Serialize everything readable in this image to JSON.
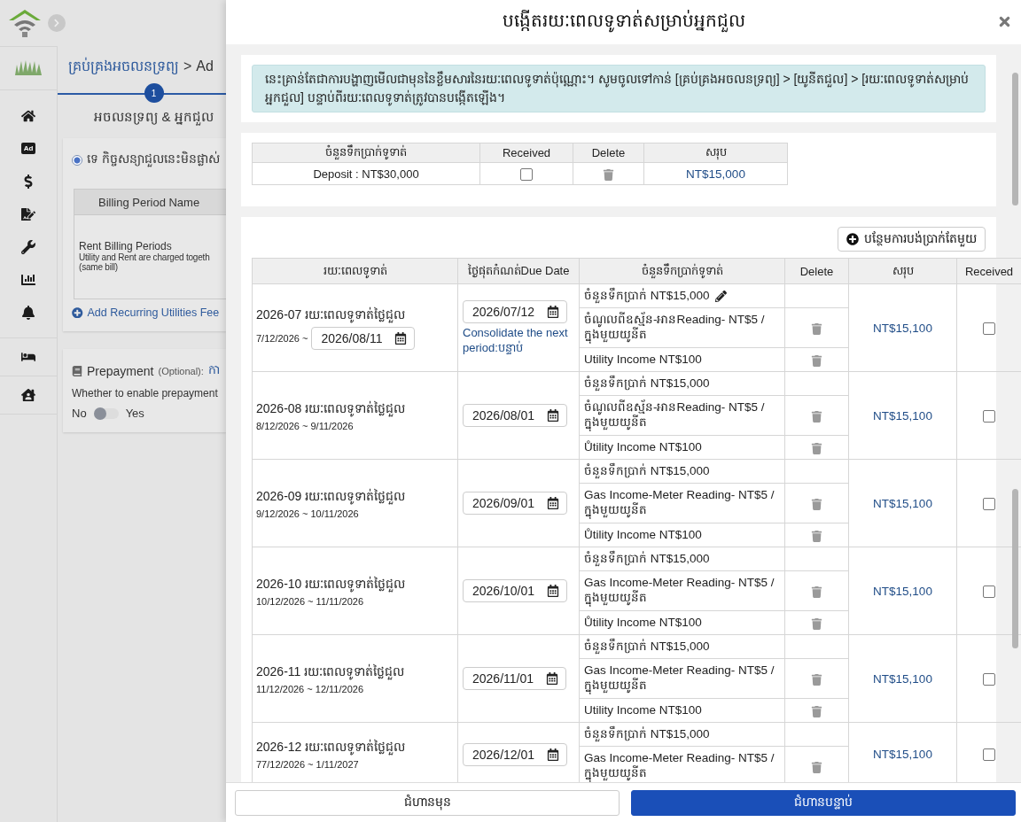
{
  "background": {
    "sidebar": {
      "items": [
        {
          "kind": "home"
        },
        {
          "kind": "ad",
          "label": "Ad"
        },
        {
          "kind": "dollar"
        },
        {
          "kind": "sign"
        },
        {
          "kind": "wrench"
        },
        {
          "kind": "chart"
        },
        {
          "kind": "bell"
        },
        {
          "kind": "bed"
        },
        {
          "kind": "house"
        }
      ]
    },
    "breadcrumb": {
      "link": "គ្រប់គ្រងអចលនទ្រព្យ",
      "separator": ">",
      "current": "Ad"
    },
    "stepper": {
      "steps": [
        {
          "number": "1",
          "label": "អចលនទ្រព្យ & អ្នកជួល",
          "selected": true
        }
      ]
    },
    "contract_option": {
      "label": "ទេ កិច្ចសន្យាជួលនេះមិនផ្លាស់",
      "selected": true
    },
    "billing_table": {
      "columns": [
        "Billing Period Name"
      ],
      "rows": [
        {
          "title": "Rent Billing Periods",
          "note_lines": [
            "Utility and Rent are charged togeth",
            "(same bill)"
          ]
        }
      ]
    },
    "add_fee_link": "Add Recurring Utilities Fee",
    "prepayment": {
      "title": "Prepayment",
      "optional": "(Optional):",
      "link": "កា",
      "question": "Whether to enable prepayment",
      "off_label": "No",
      "on_label": "Yes",
      "on": false
    }
  },
  "dialog": {
    "title": "បង្កើតរយៈពេលទូទាត់សម្រាប់អ្នកជួល",
    "notice": "នេះគ្រាន់តែជាការបង្ហាញមើលជាមុននៃខ្លឹមសារនៃរយៈពេលទូទាត់ប៉ុណ្ណោះ។ សូមចូលទៅកាន់ [គ្រប់គ្រងអចលនទ្រព្យ] > [យូនីតជួល] > [រយៈពេលទូទាត់សម្រាប់អ្នកជួល] បន្ទាប់ពីរយៈពេលទូទាត់ត្រូវបានបង្កើតឡើង។",
    "deposit_table": {
      "columns": [
        "ចំនួនទឹកប្រាក់ទូទាត់",
        "Received",
        "Delete",
        "សរុប"
      ],
      "rows": [
        {
          "amount": "Deposit : NT$30,000",
          "received": false,
          "total": "NT$15,000"
        }
      ]
    },
    "add_button": "បន្ថែមការបង់ប្រាក់តែមួយ",
    "periods_table": {
      "columns": [
        "រយៈពេលទូទាត់",
        "ថ្ងៃផុតកំណត់Due Date",
        "ចំនួនទឹកប្រាក់ទូទាត់",
        "Delete",
        "សរុប",
        "Received"
      ],
      "rows": [
        {
          "name": "2026-07 រយៈពេលទូទាត់ថ្លៃជួល",
          "range": "7/12/2026 ~",
          "end_date": "2026/08/11",
          "due_date": "2026/07/12",
          "consolidate": "Consolidate the next period:បន្ទាប់",
          "items": [
            {
              "text": "ចំនួនទឹកប្រាក់  NT$15,000",
              "editable": true,
              "deletable": false
            },
            {
              "text": "ចំណូលពីឧស្ម័ន-អានReading- NT$5 / ក្នុងមួយយូនីត",
              "editable": false,
              "deletable": true
            },
            {
              "text": "Utility Income NT$100",
              "editable": false,
              "deletable": true
            }
          ],
          "total": "NT$15,100",
          "received": false
        },
        {
          "name": "2026-08 រយៈពេលទូទាត់ថ្លៃជួល",
          "range": "8/12/2026 ~ 9/11/2026",
          "due_date": "2026/08/01",
          "items": [
            {
              "text": "ចំនួនទឹកប្រាក់  NT$15,000",
              "editable": false,
              "deletable": false
            },
            {
              "text": "ចំណូលពីឧស្ម័ន-អានReading- NT$5 / ក្នុងមួយយូនីត",
              "editable": false,
              "deletable": true
            },
            {
              "text": "Ůtility Income NT$100",
              "editable": false,
              "deletable": true
            }
          ],
          "total": "NT$15,100",
          "received": false
        },
        {
          "name": "2026-09 រយៈពេលទូទាត់ថ្លៃជួល",
          "range": "9/12/2026 ~ 10/11/2026",
          "due_date": "2026/09/01",
          "items": [
            {
              "text": "ចំនួនទឹកប្រាក់  NT$15,000",
              "editable": false,
              "deletable": false
            },
            {
              "text": "Gas Income-Meter Reading- NT$5 / ក្នុងមួយយូនីត",
              "editable": false,
              "deletable": true
            },
            {
              "text": "Ůtility Income NT$100",
              "editable": false,
              "deletable": true
            }
          ],
          "total": "NT$15,100",
          "received": false
        },
        {
          "name": "2026-10 រយៈពេលទូទាត់ថ្លៃជួល",
          "range": "10/12/2026 ~ 11/11/2026",
          "due_date": "2026/10/01",
          "items": [
            {
              "text": "ចំនួនទឹកប្រាក់  NT$15,000",
              "editable": false,
              "deletable": false
            },
            {
              "text": "Gas Income-Meter Reading- NT$5 / ក្នុងមួយយូនីត",
              "editable": false,
              "deletable": true
            },
            {
              "text": "Ůtility Income NT$100",
              "editable": false,
              "deletable": true
            }
          ],
          "total": "NT$15,100",
          "received": false
        },
        {
          "name": "2026-11 រយៈពេលទូទាត់ថ្លៃជួល",
          "range": "11/12/2026 ~ 12/11/2026",
          "due_date": "2026/11/01",
          "items": [
            {
              "text": "ចំនួនទឹកប្រាក់  NT$15,000",
              "editable": false,
              "deletable": false
            },
            {
              "text": "Gas Income-Meter Reading- NT$5 / ក្នុងមួយយូនីត",
              "editable": false,
              "deletable": true
            },
            {
              "text": "Utility Income NT$100",
              "editable": false,
              "deletable": true
            }
          ],
          "total": "NT$15,100",
          "received": false
        },
        {
          "name": "2026-12 រយៈពេលទូទាត់ថ្លៃជួល",
          "range": "77/12/2026 ~ 1/11/2027",
          "due_date": "2026/12/01",
          "items": [
            {
              "text": "ចំនួនទឹកប្រាក់  NT$15,000",
              "editable": false,
              "deletable": false
            },
            {
              "text": "Gas Income-Meter Reading- NT$5 / ក្នុងមួយយូនីត",
              "editable": false,
              "deletable": true
            }
          ],
          "total": "NT$15,100",
          "received": false
        }
      ]
    },
    "footer": {
      "back": "ជំហានមុន",
      "next": "ជំហានបន្ទាប់"
    }
  }
}
